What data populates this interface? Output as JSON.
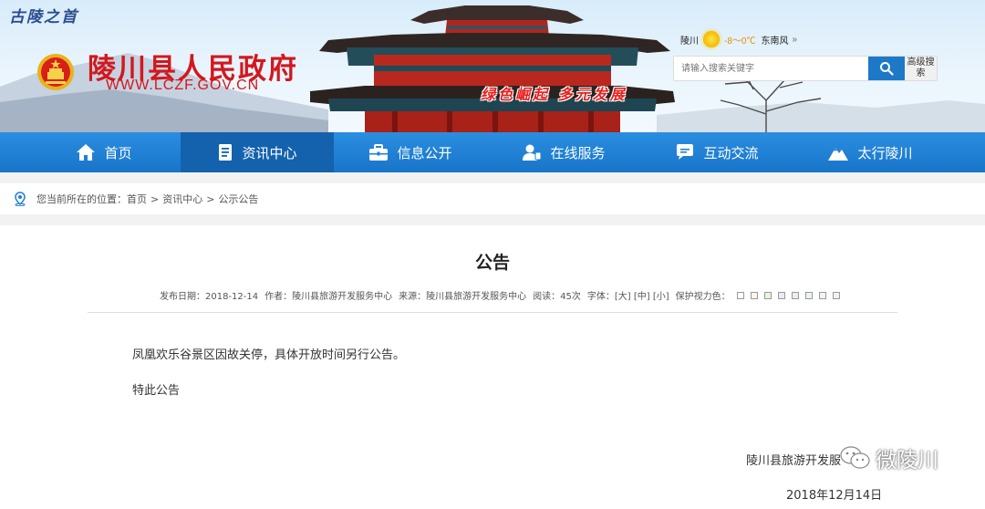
{
  "header": {
    "slogan_top": "古陵之首",
    "site_title": "陵川县人民政府",
    "site_url": "WWW.LCZF.GOV.CN",
    "slogan_red": "绿色崛起 多元发展",
    "weather": {
      "city": "陵川",
      "temp": "-8～0℃",
      "wind": "东南风",
      "icon": "sun-icon"
    },
    "search": {
      "placeholder": "请输入搜索关键字",
      "button_icon": "search-icon",
      "advanced": "高级搜索"
    }
  },
  "nav": {
    "items": [
      {
        "label": "首页",
        "icon": "home-icon"
      },
      {
        "label": "资讯中心",
        "icon": "document-icon",
        "active": true
      },
      {
        "label": "信息公开",
        "icon": "briefcase-icon"
      },
      {
        "label": "在线服务",
        "icon": "user-service-icon"
      },
      {
        "label": "互动交流",
        "icon": "chat-icon"
      },
      {
        "label": "太行陵川",
        "icon": "mountain-icon"
      }
    ]
  },
  "breadcrumb": {
    "prefix": "您当前所在的位置：",
    "items": [
      "首页",
      "资讯中心",
      "公示公告"
    ],
    "separator": ">"
  },
  "article": {
    "title": "公告",
    "meta": {
      "publish_date": "发布日期：2018-12-14",
      "author": "作者：陵川县旅游开发服务中心",
      "source": "来源：陵川县旅游开发服务中心",
      "views": "阅读：45次",
      "font_label": "字体：",
      "font_sizes": [
        "[大]",
        "[中]",
        "[小]"
      ],
      "eye_care_label": "保护视力色：",
      "eye_care_colors": [
        "#ffffff",
        "#faf5e6",
        "#e8f3e0",
        "#e8ecf8",
        "#f3e9f0",
        "#eaf4f0",
        "#eef5f8",
        "#f2f2f2"
      ]
    },
    "paragraphs": [
      "凤凰欢乐谷景区因故关停，具体开放时间另行公告。",
      "特此公告"
    ],
    "signer": "陵川县旅游开发服",
    "date": "2018年12月14日"
  },
  "watermark": {
    "text": "微陵川",
    "icon": "wechat-icon"
  }
}
